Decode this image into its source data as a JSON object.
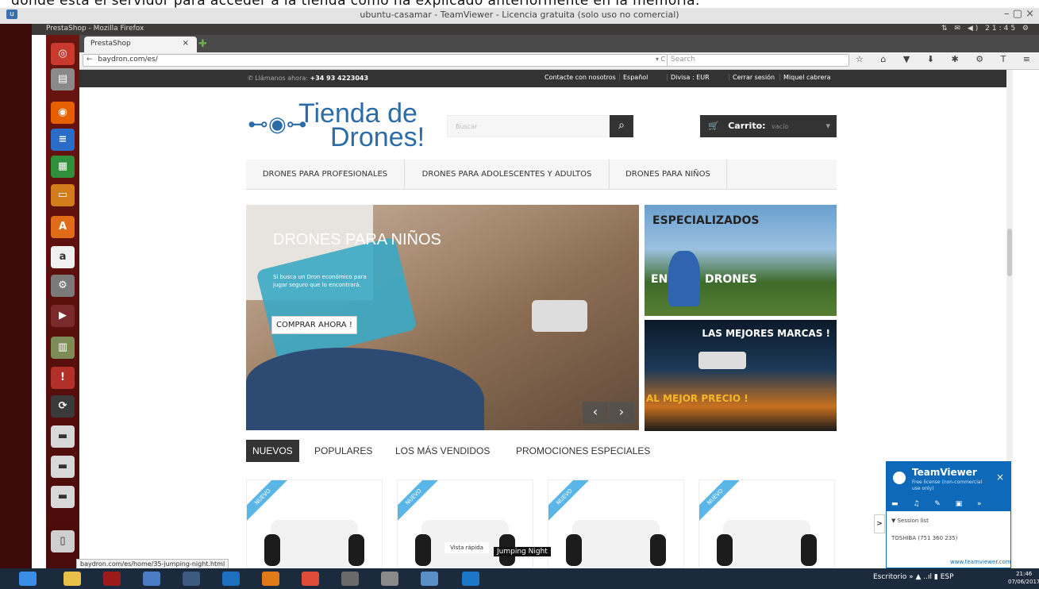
{
  "caption": "donde está el servidor para acceder a la tienda como ha explicado anteriormente en la memoria.",
  "teamviewer_window": {
    "title": "ubuntu-casamar - TeamViewer - Licencia gratuita (solo uso no comercial)",
    "controls": "– ▢ ×"
  },
  "ubuntu_panel": {
    "title": "PrestaShop - Mozilla Firefox",
    "indicators": "⇅ ✉ ◀) 21:45 ⚙"
  },
  "launcher": {
    "items": [
      {
        "name": "ubuntu-dash",
        "glyph": "◎",
        "color": "#c8392e"
      },
      {
        "name": "files",
        "glyph": "▤",
        "color": "#8a8a8a"
      },
      {
        "name": "firefox",
        "glyph": "◉",
        "color": "#e66000"
      },
      {
        "name": "writer",
        "glyph": "≡",
        "color": "#2a6cc7"
      },
      {
        "name": "calc",
        "glyph": "▦",
        "color": "#2f8f3a"
      },
      {
        "name": "impress",
        "glyph": "▭",
        "color": "#d27c1c"
      },
      {
        "name": "software-center",
        "glyph": "A",
        "color": "#e06c17"
      },
      {
        "name": "amazon",
        "glyph": "a",
        "color": "#f0f0f0"
      },
      {
        "name": "settings",
        "glyph": "⚙",
        "color": "#7a7a7a"
      },
      {
        "name": "youtube",
        "glyph": "▶",
        "color": "#7a2a2a"
      },
      {
        "name": "folder",
        "glyph": "▥",
        "color": "#7d8b57"
      },
      {
        "name": "bulb",
        "glyph": "!",
        "color": "#b2302a"
      },
      {
        "name": "update",
        "glyph": "⟳",
        "color": "#3a3a3a"
      },
      {
        "name": "drive-1",
        "glyph": "▬",
        "color": "#d8d8d8"
      },
      {
        "name": "drive-2",
        "glyph": "▬",
        "color": "#d8d8d8"
      },
      {
        "name": "drive-3",
        "glyph": "▬",
        "color": "#d8d8d8"
      },
      {
        "name": "trash",
        "glyph": "▯",
        "color": "#cfcfcf"
      }
    ]
  },
  "browser": {
    "tab_label": "PrestaShop",
    "tab_close": "×",
    "new_tab": "✚",
    "url": "baydron.com/es/",
    "url_back": "←",
    "url_dropdown": "▾ C",
    "search_placeholder": "Search",
    "toolbar_icons": "☆ ⌂ ▼ ⬇ ✱ ⚙ T ≡"
  },
  "site": {
    "phone_label": "Llámanos ahora:",
    "phone_number": "+34 93 4223043",
    "topbar": [
      "Contacte con nosotros",
      "Español",
      "Divisa : EUR",
      "Cerrar sesión",
      "Miquel cabrera"
    ],
    "logo_line1": "Tienda de",
    "logo_line2": "Drones!",
    "search_placeholder": "Buscar",
    "search_icon": "🔍",
    "cart_label": "Carrito:",
    "cart_value": "vacío",
    "menu": [
      "DRONES PARA PROFESIONALES",
      "DRONES PARA ADOLESCENTES Y ADULTOS",
      "DRONES PARA NIÑOS"
    ],
    "slider": {
      "title": "DRONES PARA NIÑOS",
      "text": "Si busca un Dron económico para jugar seguro que lo encontrará.",
      "button": "COMPRAR AHORA !",
      "prev": "‹",
      "next": "›"
    },
    "banner1": {
      "top": "ESPECIALIZADOS",
      "left": "EN",
      "right": "DRONES"
    },
    "banner2": {
      "top": "LAS MEJORES MARCAS !",
      "bottom": "AL MEJOR PRECIO !"
    },
    "product_tabs": [
      "NUEVOS",
      "POPULARES",
      "LOS MÁS VENDIDOS",
      "PROMOCIONES ESPECIALES"
    ],
    "products": [
      {
        "badge": "NUEVO"
      },
      {
        "badge": "NUEVO"
      },
      {
        "badge": "NUEVO"
      },
      {
        "badge": "NUEVO"
      }
    ],
    "hover_quick_view": "Vista rápida",
    "tooltip": "Jumping Night",
    "status_url": "baydron.com/es/home/35-jumping-night.html"
  },
  "teamviewer_panel": {
    "name": "TeamViewer",
    "subtitle": "Free license (non-commercial use only)",
    "close": "×",
    "icons": "▬ ♫ ✎ ▣ »",
    "session_label": "▼ Session list",
    "session_item": "TOSHIBA (751 360 235)",
    "footer": "www.teamviewer.com",
    "collapse": ">"
  },
  "taskbar": {
    "tray_label": "Escritorio",
    "tray_icons": "» ▲ ..ıl ▮ ESP",
    "time": "21:46",
    "date": "07/06/2017"
  }
}
